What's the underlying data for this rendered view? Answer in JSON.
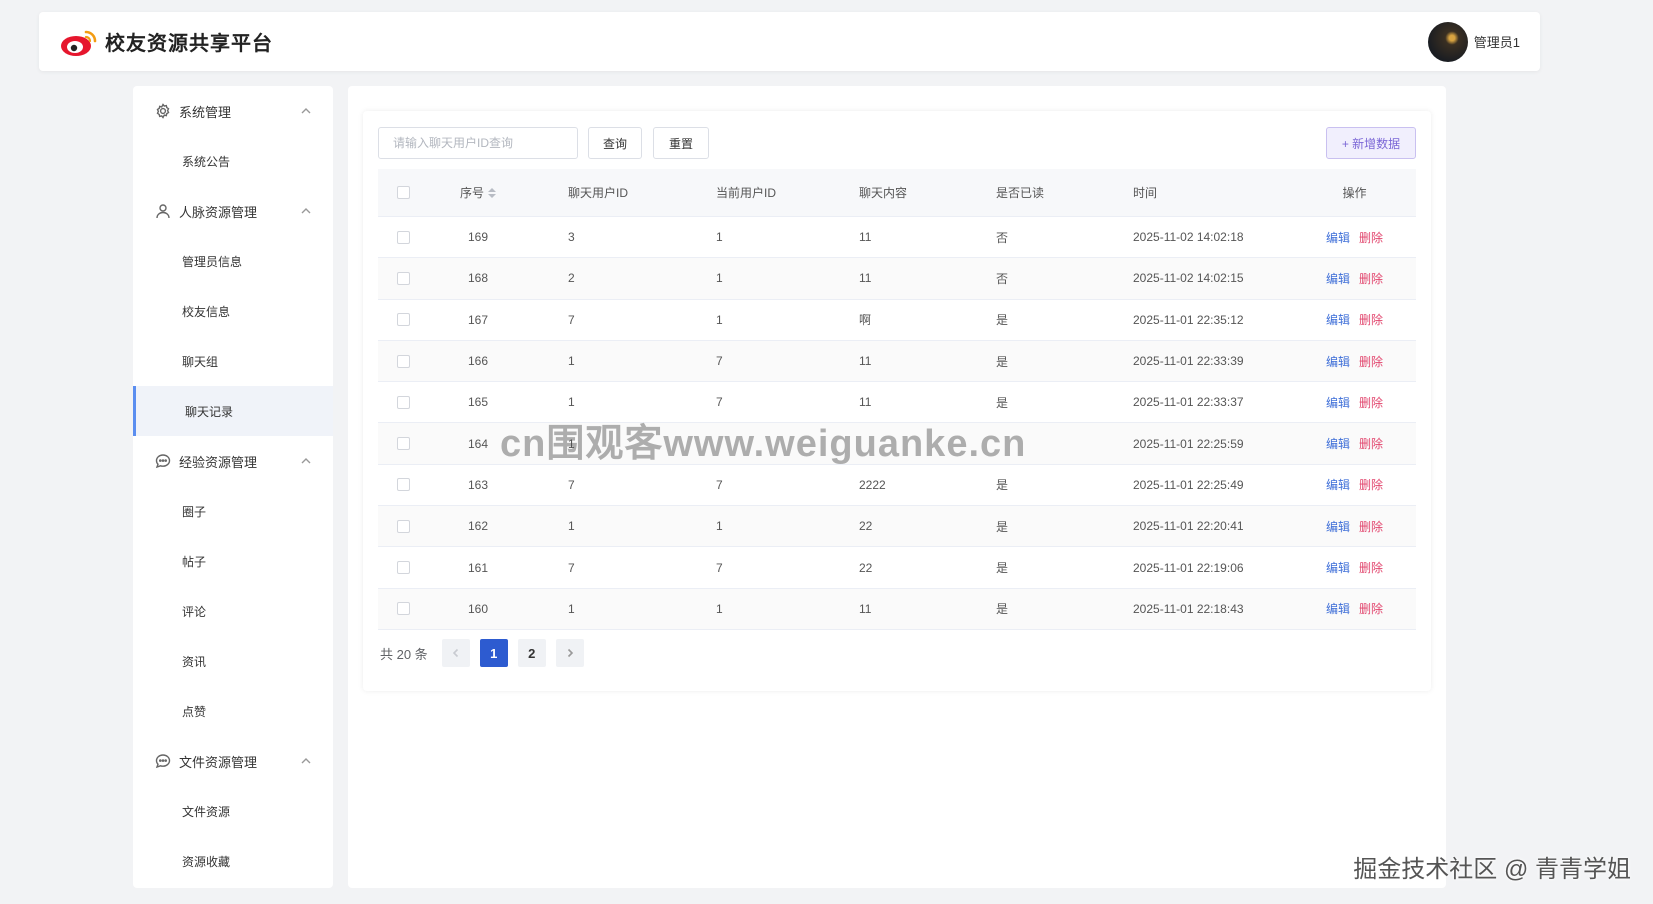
{
  "app": {
    "title": "校友资源共享平台",
    "user_name": "管理员1"
  },
  "sidebar": {
    "groups": [
      {
        "label": "系统管理",
        "icon": "gear-icon",
        "items": [
          "系统公告"
        ]
      },
      {
        "label": "人脉资源管理",
        "icon": "user-icon",
        "items": [
          "管理员信息",
          "校友信息",
          "聊天组",
          "聊天记录"
        ]
      },
      {
        "label": "经验资源管理",
        "icon": "chat-icon",
        "items": [
          "圈子",
          "帖子",
          "评论",
          "资讯",
          "点赞"
        ]
      },
      {
        "label": "文件资源管理",
        "icon": "chat-icon",
        "items": [
          "文件资源",
          "资源收藏"
        ]
      }
    ],
    "active_item": "聊天记录"
  },
  "toolbar": {
    "search_placeholder": "请输入聊天用户ID查询",
    "query_label": "查询",
    "reset_label": "重置",
    "add_label": "+ 新增数据"
  },
  "table": {
    "headers": [
      "序号",
      "聊天用户ID",
      "当前用户ID",
      "聊天内容",
      "是否已读",
      "时间",
      "操作"
    ],
    "edit_label": "编辑",
    "delete_label": "删除",
    "rows": [
      {
        "id": "169",
        "uid": "3",
        "cur": "1",
        "content": "11",
        "read": "否",
        "time": "2025-11-02 14:02:18"
      },
      {
        "id": "168",
        "uid": "2",
        "cur": "1",
        "content": "11",
        "read": "否",
        "time": "2025-11-02 14:02:15"
      },
      {
        "id": "167",
        "uid": "7",
        "cur": "1",
        "content": "啊",
        "read": "是",
        "time": "2025-11-01 22:35:12"
      },
      {
        "id": "166",
        "uid": "1",
        "cur": "7",
        "content": "11",
        "read": "是",
        "time": "2025-11-01 22:33:39"
      },
      {
        "id": "165",
        "uid": "1",
        "cur": "7",
        "content": "11",
        "read": "是",
        "time": "2025-11-01 22:33:37"
      },
      {
        "id": "164",
        "uid": "1",
        "cur": "",
        "content": "",
        "read": "",
        "time": "2025-11-01 22:25:59"
      },
      {
        "id": "163",
        "uid": "7",
        "cur": "7",
        "content": "2222",
        "read": "是",
        "time": "2025-11-01 22:25:49"
      },
      {
        "id": "162",
        "uid": "1",
        "cur": "1",
        "content": "22",
        "read": "是",
        "time": "2025-11-01 22:20:41"
      },
      {
        "id": "161",
        "uid": "7",
        "cur": "7",
        "content": "22",
        "read": "是",
        "time": "2025-11-01 22:19:06"
      },
      {
        "id": "160",
        "uid": "1",
        "cur": "1",
        "content": "11",
        "read": "是",
        "time": "2025-11-01 22:18:43"
      }
    ]
  },
  "pagination": {
    "total_text": "共 20 条",
    "pages": [
      "1",
      "2"
    ],
    "current": "1"
  },
  "watermarks": {
    "center": "cn围观客www.weiguanke.cn",
    "corner": "掘金技术社区 @ 青青学姐"
  }
}
